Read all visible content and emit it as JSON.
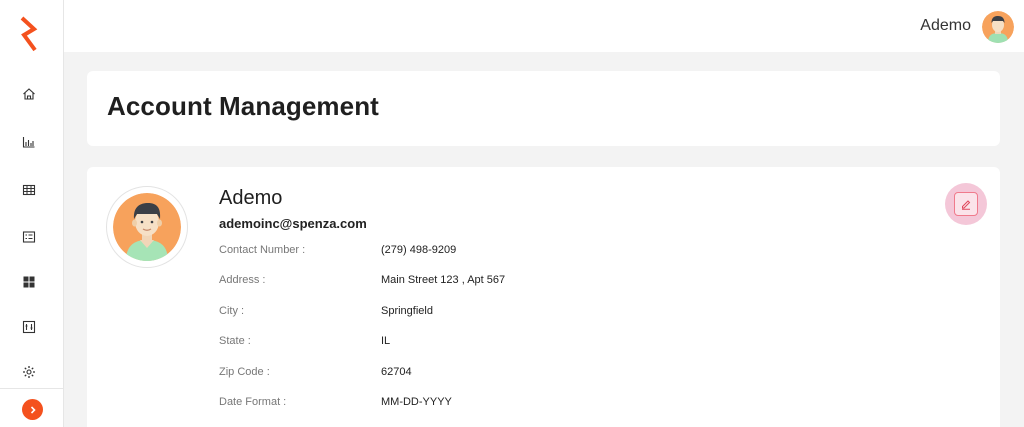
{
  "brand": {
    "logo_icon": "logo-icon",
    "accent_color": "#f4511e"
  },
  "sidebar": {
    "items": [
      {
        "id": "home",
        "icon": "home-icon"
      },
      {
        "id": "analytics",
        "icon": "bar-chart-icon"
      },
      {
        "id": "table",
        "icon": "grid-table-icon"
      },
      {
        "id": "list",
        "icon": "list-icon"
      },
      {
        "id": "dashboard",
        "icon": "dashboard-icon"
      },
      {
        "id": "reports",
        "icon": "report-icon"
      },
      {
        "id": "settings",
        "icon": "gear-icon"
      }
    ],
    "expand_icon": "chevron-right-icon"
  },
  "header": {
    "user_name": "Ademo",
    "avatar_icon": "avatar-icon"
  },
  "page": {
    "title": "Account Management"
  },
  "profile": {
    "name": "Ademo",
    "email": "ademoinc@spenza.com",
    "edit_icon": "edit-icon",
    "fields": [
      {
        "label": "Contact Number :",
        "value": "(279) 498-9209"
      },
      {
        "label": "Address :",
        "value": "Main Street 123 , Apt 567"
      },
      {
        "label": "City :",
        "value": "Springfield"
      },
      {
        "label": "State :",
        "value": "IL"
      },
      {
        "label": "Zip Code :",
        "value": "62704"
      },
      {
        "label": "Date Format :",
        "value": "MM-DD-YYYY"
      }
    ]
  }
}
